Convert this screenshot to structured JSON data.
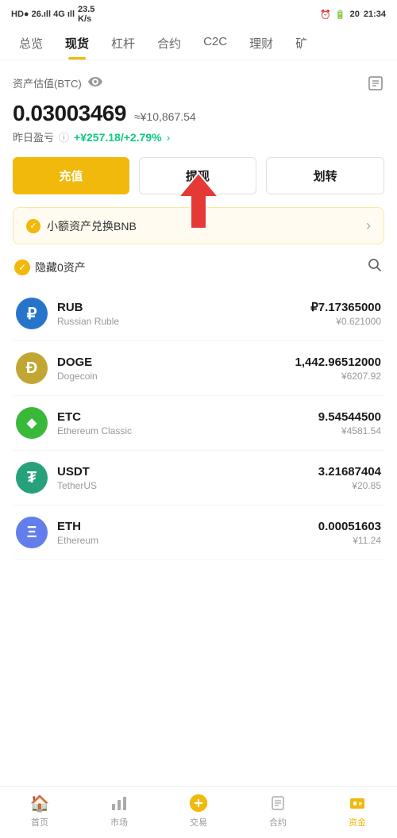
{
  "statusBar": {
    "left": "HD● 26.ıll 4G ıll",
    "speed": "23.5 K/s",
    "time": "21:34",
    "batteryLabel": "20"
  },
  "navTabs": [
    {
      "label": "总览",
      "active": false
    },
    {
      "label": "现货",
      "active": true
    },
    {
      "label": "杠杆",
      "active": false
    },
    {
      "label": "合约",
      "active": false
    },
    {
      "label": "C2C",
      "active": false
    },
    {
      "label": "理财",
      "active": false
    },
    {
      "label": "矿",
      "active": false
    }
  ],
  "assetSection": {
    "label": "资产估值(BTC)",
    "btcValue": "0.03003469",
    "cnyApprox": "≈¥10,867.54",
    "profitLabel": "昨日盈亏",
    "profitInfo": "ⓘ",
    "profitValue": "+¥257.18/+2.79%",
    "profitArrow": "›"
  },
  "buttons": {
    "recharge": "充值",
    "withdraw": "提现",
    "transfer": "划转"
  },
  "bnbBanner": {
    "text": "小额资产兑换BNB",
    "arrow": "›"
  },
  "filterRow": {
    "label": "隐藏0资产"
  },
  "assets": [
    {
      "symbol": "RUB",
      "name": "Russian Ruble",
      "amount": "₽7.17365000",
      "cny": "¥0.621000",
      "iconType": "rub",
      "iconText": "₽"
    },
    {
      "symbol": "DOGE",
      "name": "Dogecoin",
      "amount": "1,442.96512000",
      "cny": "¥6207.92",
      "iconType": "doge",
      "iconText": "Ð"
    },
    {
      "symbol": "ETC",
      "name": "Ethereum Classic",
      "amount": "9.54544500",
      "cny": "¥4581.54",
      "iconType": "etc",
      "iconText": "◆"
    },
    {
      "symbol": "USDT",
      "name": "TetherUS",
      "amount": "3.21687404",
      "cny": "¥20.85",
      "iconType": "usdt",
      "iconText": "₮"
    },
    {
      "symbol": "ETH",
      "name": "Ethereum",
      "amount": "0.00051603",
      "cny": "¥11.24",
      "iconType": "eth",
      "iconText": "Ξ"
    }
  ],
  "bottomNav": [
    {
      "label": "首页",
      "active": false,
      "icon": "🏠"
    },
    {
      "label": "市场",
      "active": false,
      "icon": "📊"
    },
    {
      "label": "交易",
      "active": false,
      "icon": "🔄"
    },
    {
      "label": "合约",
      "active": false,
      "icon": "📄"
    },
    {
      "label": "资金",
      "active": true,
      "icon": "💰"
    }
  ]
}
